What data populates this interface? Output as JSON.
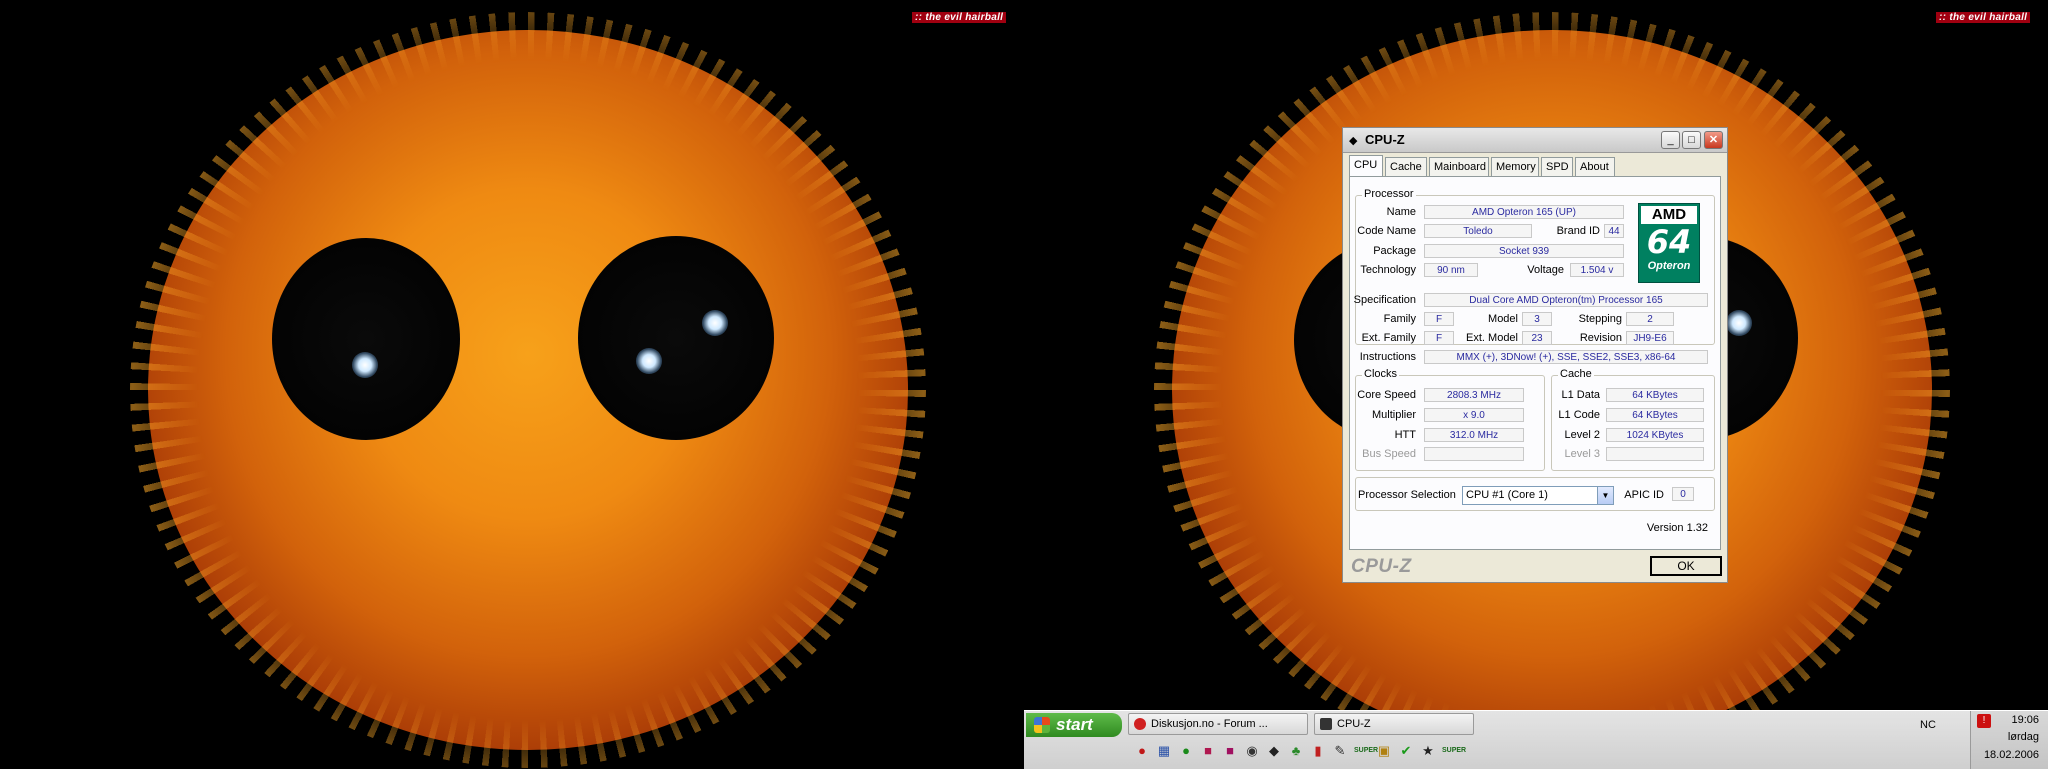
{
  "wallpaper": {
    "tag_left": ":: the evil hairball",
    "tag_right": ":: the evil hairball"
  },
  "window": {
    "title": "CPU-Z",
    "controls": {
      "minimize": "_",
      "maximize": "□",
      "close": "✕"
    },
    "tabs": [
      "CPU",
      "Cache",
      "Mainboard",
      "Memory",
      "SPD",
      "About"
    ],
    "active_tab": "CPU",
    "processor": {
      "group_title": "Processor",
      "name_label": "Name",
      "name": "AMD Opteron 165 (UP)",
      "code_name_label": "Code Name",
      "code_name": "Toledo",
      "brand_id_label": "Brand ID",
      "brand_id": "44",
      "package_label": "Package",
      "package": "Socket 939",
      "technology_label": "Technology",
      "technology": "90 nm",
      "voltage_label": "Voltage",
      "voltage": "1.504 v",
      "specification_label": "Specification",
      "specification": "Dual Core AMD Opteron(tm) Processor 165",
      "family_label": "Family",
      "family": "F",
      "model_label": "Model",
      "model": "3",
      "stepping_label": "Stepping",
      "stepping": "2",
      "ext_family_label": "Ext. Family",
      "ext_family": "F",
      "ext_model_label": "Ext. Model",
      "ext_model": "23",
      "revision_label": "Revision",
      "revision": "JH9-E6",
      "instructions_label": "Instructions",
      "instructions": "MMX (+), 3DNow! (+), SSE, SSE2, SSE3, x86-64"
    },
    "logo": {
      "top": "AMD",
      "middle": "64",
      "bottom": "Opteron"
    },
    "clocks": {
      "group_title": "Clocks",
      "core_speed_label": "Core Speed",
      "core_speed": "2808.3 MHz",
      "multiplier_label": "Multiplier",
      "multiplier": "x 9.0",
      "htt_label": "HTT",
      "htt": "312.0 MHz",
      "bus_speed_label": "Bus Speed",
      "bus_speed": ""
    },
    "cache": {
      "group_title": "Cache",
      "l1_data_label": "L1 Data",
      "l1_data": "64 KBytes",
      "l1_code_label": "L1 Code",
      "l1_code": "64 KBytes",
      "level2_label": "Level 2",
      "level2": "1024 KBytes",
      "level3_label": "Level 3",
      "level3": ""
    },
    "selection": {
      "label": "Processor Selection",
      "value": "CPU #1 (Core 1)",
      "apic_label": "APIC ID",
      "apic_id": "0"
    },
    "version": "Version 1.32",
    "footer_brand": "CPU-Z",
    "ok_label": "OK"
  },
  "taskbar": {
    "start_label": "start",
    "tasks": [
      "Diskusjon.no - Forum ...",
      "CPU-Z"
    ],
    "quick_launch": [
      "opera-icon",
      "network-icon",
      "info-icon",
      "app-icon",
      "app-icon",
      "steam-icon",
      "cpuz-icon",
      "plant-icon",
      "tool-icon",
      "tool-icon",
      "super-icon",
      "image-icon",
      "check-icon",
      "star-icon",
      "super-icon"
    ],
    "super_label": "SUPER",
    "language": "NC",
    "time": "19:06",
    "day": "lørdag",
    "date": "18.02.2006"
  },
  "colors": {
    "accent_value": "#2a2aa0",
    "amd_green": "#008060",
    "start_green": "#3a9a2a"
  }
}
